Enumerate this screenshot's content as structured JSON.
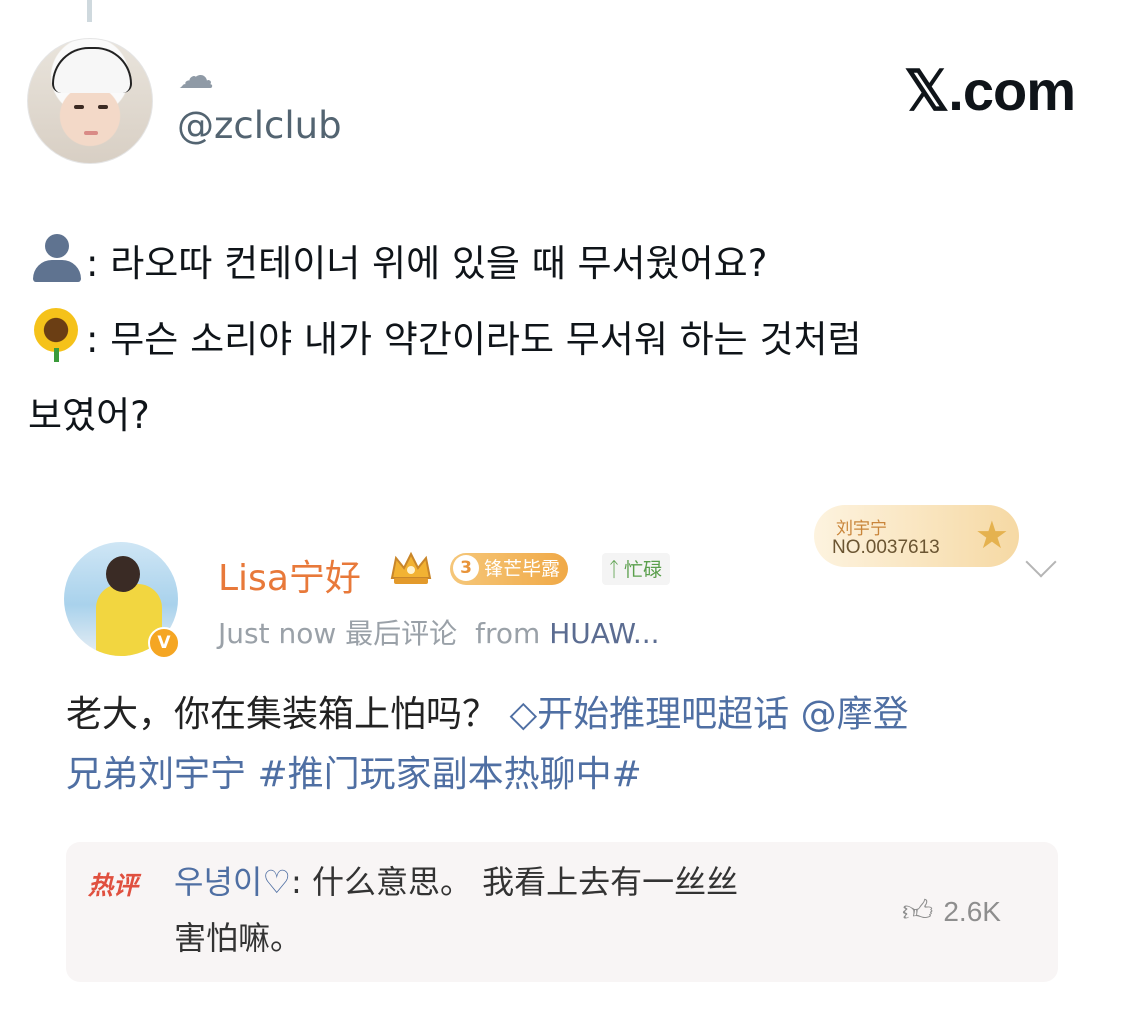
{
  "header": {
    "cloud_emoji": "☁",
    "handle": "@zclclub",
    "brand": "𝕏.com"
  },
  "tweet": {
    "line1_prefix": ": ",
    "line1": "라오따 컨테이너 위에 있을 때 무서웠어요?",
    "line2_prefix": ": ",
    "line2": "무슨 소리야 내가 약간이라도 무서워 하는 것처럼",
    "line3": "보였어?"
  },
  "comment": {
    "user_name": "Lisa宁好",
    "verified_badge": "V",
    "level_badge_num": "3",
    "level_badge_text": "锋芒毕露",
    "busy_badge_text": "忙碌",
    "fan_card": {
      "name": "刘宇宁",
      "number": "NO.0037613"
    },
    "meta_time": "Just now 最后评论",
    "meta_from": "from",
    "meta_device": "HUAW...",
    "text_plain": "老大，你在集装箱上怕吗？",
    "text_link1": "◇开始推理吧超话",
    "text_link2": "@摩登",
    "text_link3": "兄弟刘宇宁",
    "text_link4": "#推门玩家副本热聊中#",
    "hot": {
      "tag": "热评",
      "user": "우녕이♡",
      "text": ": 什么意思。 我看上去有一丝丝",
      "text2": "害怕嘛。",
      "likes": "2.6K"
    }
  },
  "colors": {
    "accent_orange": "#e8793a",
    "link_blue": "#4f6fa3",
    "hot_red": "#e0503f"
  }
}
